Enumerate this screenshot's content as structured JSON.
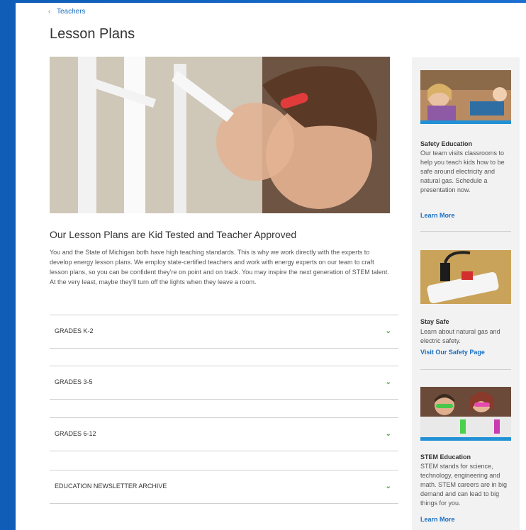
{
  "breadcrumb": {
    "label": "Teachers"
  },
  "page_title": "Lesson Plans",
  "main": {
    "section_title": "Our Lesson Plans are Kid Tested and Teacher Approved",
    "intro": "You and the State of Michigan both have high teaching standards. This is why we work directly with the experts to develop energy lesson plans. We employ state-certified teachers and work with energy experts on our team to craft lesson plans, so you can be confident they’re on point and on track. You may inspire the next generation of STEM talent. At the very least, maybe they’ll turn off the lights when they leave a room.",
    "accordion": [
      {
        "label": "GRADES K-2"
      },
      {
        "label": "GRADES 3-5"
      },
      {
        "label": "GRADES 6-12"
      },
      {
        "label": "EDUCATION NEWSLETTER ARCHIVE"
      }
    ]
  },
  "sidebar": {
    "cards": [
      {
        "heading": "Safety Education",
        "text": "Our team visits classrooms to help you teach kids how to be safe around electricity and natural gas. Schedule a presentation now.",
        "link": "Learn More"
      },
      {
        "heading": "Stay Safe",
        "text": "Learn about natural gas and electric safety.",
        "link": "Visit Our Safety Page"
      },
      {
        "heading": "STEM Education",
        "text": "STEM stands for science, technology, engineering and math. STEM careers are in big demand and can lead to big things for you.",
        "link": "Learn More"
      }
    ]
  },
  "colors": {
    "link": "#1a6fc0",
    "accent_blue": "#2291d6",
    "chevron_green": "#5aa34b"
  }
}
